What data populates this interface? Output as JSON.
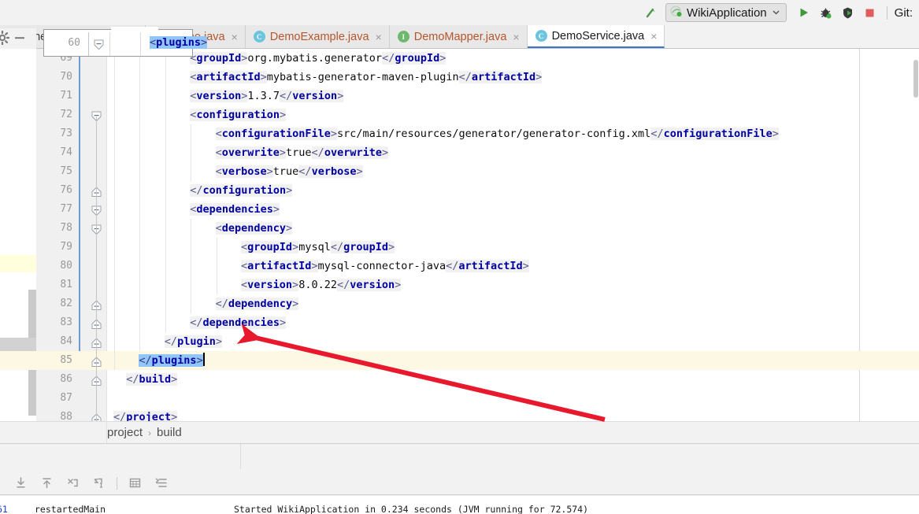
{
  "toolbar": {
    "build_icon": "hammer-icon",
    "run_config": "WikiApplication",
    "dropdown_icon": "chevron-down-icon",
    "run_icon": "run-icon",
    "debug_icon": "debug-icon",
    "coverage_icon": "run-with-coverage-icon",
    "stop_icon": "stop-icon",
    "git_label": "Git:"
  },
  "tool_window": {
    "settings_icon": "gear-icon",
    "minimize_icon": "minimize-icon"
  },
  "tabs": [
    {
      "label": "enerator-config.xml",
      "icon": "xml-file-icon",
      "icon_kind": "xml",
      "active": false,
      "text_style": "plain",
      "close": "×"
    },
    {
      "label": "Demo.java",
      "icon": "java-class-icon",
      "icon_kind": "cls",
      "icon_letter": "C",
      "active": false,
      "text_style": "modified",
      "close": "×"
    },
    {
      "label": "DemoExample.java",
      "icon": "java-class-icon",
      "icon_kind": "cls",
      "icon_letter": "C",
      "active": false,
      "text_style": "modified",
      "close": "×"
    },
    {
      "label": "DemoMapper.java",
      "icon": "java-interface-icon",
      "icon_kind": "iface",
      "icon_letter": "I",
      "active": false,
      "text_style": "modified",
      "close": "×"
    },
    {
      "label": "DemoService.java",
      "icon": "java-class-icon",
      "icon_kind": "cls",
      "icon_letter": "C",
      "active": true,
      "text_style": "plain",
      "close": "×"
    }
  ],
  "tag_popup": {
    "line_number": "60",
    "open_bracket": "<",
    "tag_name": "plugins",
    "close_bracket": ">",
    "fold_icon": "fold-collapse-icon"
  },
  "editor": {
    "lines": [
      {
        "n": "69",
        "indent": 12,
        "parts": [
          {
            "t": "br",
            "v": "<"
          },
          {
            "t": "tg",
            "v": "groupId"
          },
          {
            "t": "br",
            "v": ">"
          },
          {
            "t": "txt",
            "v": "org.mybatis.generator"
          },
          {
            "t": "br",
            "v": "</"
          },
          {
            "t": "tg",
            "v": "groupId"
          },
          {
            "t": "br",
            "v": ">"
          }
        ]
      },
      {
        "n": "70",
        "indent": 12,
        "parts": [
          {
            "t": "br",
            "v": "<"
          },
          {
            "t": "tg",
            "v": "artifactId"
          },
          {
            "t": "br",
            "v": ">"
          },
          {
            "t": "txt",
            "v": "mybatis-generator-maven-plugin"
          },
          {
            "t": "br",
            "v": "</"
          },
          {
            "t": "tg",
            "v": "artifactId"
          },
          {
            "t": "br",
            "v": ">"
          }
        ]
      },
      {
        "n": "71",
        "indent": 12,
        "parts": [
          {
            "t": "br",
            "v": "<"
          },
          {
            "t": "tg",
            "v": "version"
          },
          {
            "t": "br",
            "v": ">"
          },
          {
            "t": "txt",
            "v": "1.3.7"
          },
          {
            "t": "br",
            "v": "</"
          },
          {
            "t": "tg",
            "v": "version"
          },
          {
            "t": "br",
            "v": ">"
          }
        ]
      },
      {
        "n": "72",
        "indent": 12,
        "fold": "open",
        "parts": [
          {
            "t": "br",
            "v": "<"
          },
          {
            "t": "tg",
            "v": "configuration"
          },
          {
            "t": "br",
            "v": ">"
          }
        ]
      },
      {
        "n": "73",
        "indent": 16,
        "parts": [
          {
            "t": "br",
            "v": "<"
          },
          {
            "t": "tg",
            "v": "configurationFile"
          },
          {
            "t": "br",
            "v": ">"
          },
          {
            "t": "txt",
            "v": "src/main/resources/generator/generator-config.xml"
          },
          {
            "t": "br",
            "v": "</"
          },
          {
            "t": "tg",
            "v": "configurationFile"
          },
          {
            "t": "br",
            "v": ">"
          }
        ]
      },
      {
        "n": "74",
        "indent": 16,
        "parts": [
          {
            "t": "br",
            "v": "<"
          },
          {
            "t": "tg",
            "v": "overwrite"
          },
          {
            "t": "br",
            "v": ">"
          },
          {
            "t": "txt",
            "v": "true"
          },
          {
            "t": "br",
            "v": "</"
          },
          {
            "t": "tg",
            "v": "overwrite"
          },
          {
            "t": "br",
            "v": ">"
          }
        ]
      },
      {
        "n": "75",
        "indent": 16,
        "parts": [
          {
            "t": "br",
            "v": "<"
          },
          {
            "t": "tg",
            "v": "verbose"
          },
          {
            "t": "br",
            "v": ">"
          },
          {
            "t": "txt",
            "v": "true"
          },
          {
            "t": "br",
            "v": "</"
          },
          {
            "t": "tg",
            "v": "verbose"
          },
          {
            "t": "br",
            "v": ">"
          }
        ]
      },
      {
        "n": "76",
        "indent": 12,
        "fold": "close",
        "parts": [
          {
            "t": "br",
            "v": "</"
          },
          {
            "t": "tg",
            "v": "configuration"
          },
          {
            "t": "br",
            "v": ">"
          }
        ]
      },
      {
        "n": "77",
        "indent": 12,
        "fold": "open",
        "parts": [
          {
            "t": "br",
            "v": "<"
          },
          {
            "t": "tg",
            "v": "dependencies"
          },
          {
            "t": "br",
            "v": ">"
          }
        ]
      },
      {
        "n": "78",
        "indent": 16,
        "fold": "open",
        "parts": [
          {
            "t": "br",
            "v": "<"
          },
          {
            "t": "tg",
            "v": "dependency"
          },
          {
            "t": "br",
            "v": ">"
          }
        ]
      },
      {
        "n": "79",
        "indent": 20,
        "parts": [
          {
            "t": "br",
            "v": "<"
          },
          {
            "t": "tg",
            "v": "groupId"
          },
          {
            "t": "br",
            "v": ">"
          },
          {
            "t": "txt",
            "v": "mysql"
          },
          {
            "t": "br",
            "v": "</"
          },
          {
            "t": "tg",
            "v": "groupId"
          },
          {
            "t": "br",
            "v": ">"
          }
        ]
      },
      {
        "n": "80",
        "indent": 20,
        "parts": [
          {
            "t": "br",
            "v": "<"
          },
          {
            "t": "tg",
            "v": "artifactId"
          },
          {
            "t": "br",
            "v": ">"
          },
          {
            "t": "txt",
            "v": "mysql-connector-java"
          },
          {
            "t": "br",
            "v": "</"
          },
          {
            "t": "tg",
            "v": "artifactId"
          },
          {
            "t": "br",
            "v": ">"
          }
        ]
      },
      {
        "n": "81",
        "indent": 20,
        "parts": [
          {
            "t": "br",
            "v": "<"
          },
          {
            "t": "tg",
            "v": "version"
          },
          {
            "t": "br",
            "v": ">"
          },
          {
            "t": "txt",
            "v": "8.0.22"
          },
          {
            "t": "br",
            "v": "</"
          },
          {
            "t": "tg",
            "v": "version"
          },
          {
            "t": "br",
            "v": ">"
          }
        ]
      },
      {
        "n": "82",
        "indent": 16,
        "fold": "close",
        "parts": [
          {
            "t": "br",
            "v": "</"
          },
          {
            "t": "tg",
            "v": "dependency"
          },
          {
            "t": "br",
            "v": ">"
          }
        ]
      },
      {
        "n": "83",
        "indent": 12,
        "fold": "close",
        "parts": [
          {
            "t": "br",
            "v": "</"
          },
          {
            "t": "tg",
            "v": "dependencies"
          },
          {
            "t": "br",
            "v": ">"
          }
        ]
      },
      {
        "n": "84",
        "indent": 8,
        "fold": "close",
        "parts": [
          {
            "t": "br",
            "v": "</"
          },
          {
            "t": "tg",
            "v": "plugin"
          },
          {
            "t": "br",
            "v": ">"
          }
        ]
      },
      {
        "n": "85",
        "indent": 4,
        "fold": "close",
        "current": true,
        "parts": [
          {
            "t": "selbr",
            "v": "</"
          },
          {
            "t": "sel",
            "v": "plugins"
          },
          {
            "t": "selbr",
            "v": ">"
          },
          {
            "t": "caret",
            "v": ""
          }
        ]
      },
      {
        "n": "86",
        "indent": 2,
        "fold": "close",
        "parts": [
          {
            "t": "br",
            "v": "</"
          },
          {
            "t": "tg",
            "v": "build"
          },
          {
            "t": "br",
            "v": ">"
          }
        ]
      },
      {
        "n": "87",
        "indent": 0,
        "parts": []
      },
      {
        "n": "88",
        "indent": 0,
        "fold": "close",
        "parts": [
          {
            "t": "br",
            "v": "</"
          },
          {
            "t": "tg",
            "v": "project"
          },
          {
            "t": "br",
            "v": ">"
          }
        ]
      }
    ]
  },
  "breadcrumb": {
    "items": [
      "project",
      "build"
    ],
    "separator": "›"
  },
  "bottom_toolbar": {
    "icons": [
      "scroll-to-bottom-icon",
      "scroll-to-top-icon",
      "soft-wrap-icon",
      "scroll-to-end-icon",
      "print-icon",
      "indent-icon"
    ]
  },
  "console": {
    "thread_id": "61",
    "thread_name": "restartedMain",
    "message": "Started WikiApplication in 0.234 seconds (JVM running for 72.574)"
  },
  "annotation": {
    "arrow_color": "#e8192c",
    "points_at": "line-84-closing-plugin-tag"
  },
  "colors": {
    "tag": "#0000a0",
    "selection": "#92c5f8",
    "current_line": "#fdf8e3",
    "accent": "#3c76c9",
    "run_green": "#3e9c3e",
    "stop_red": "#e05c5c",
    "modified_tab_text": "#b5552a"
  }
}
